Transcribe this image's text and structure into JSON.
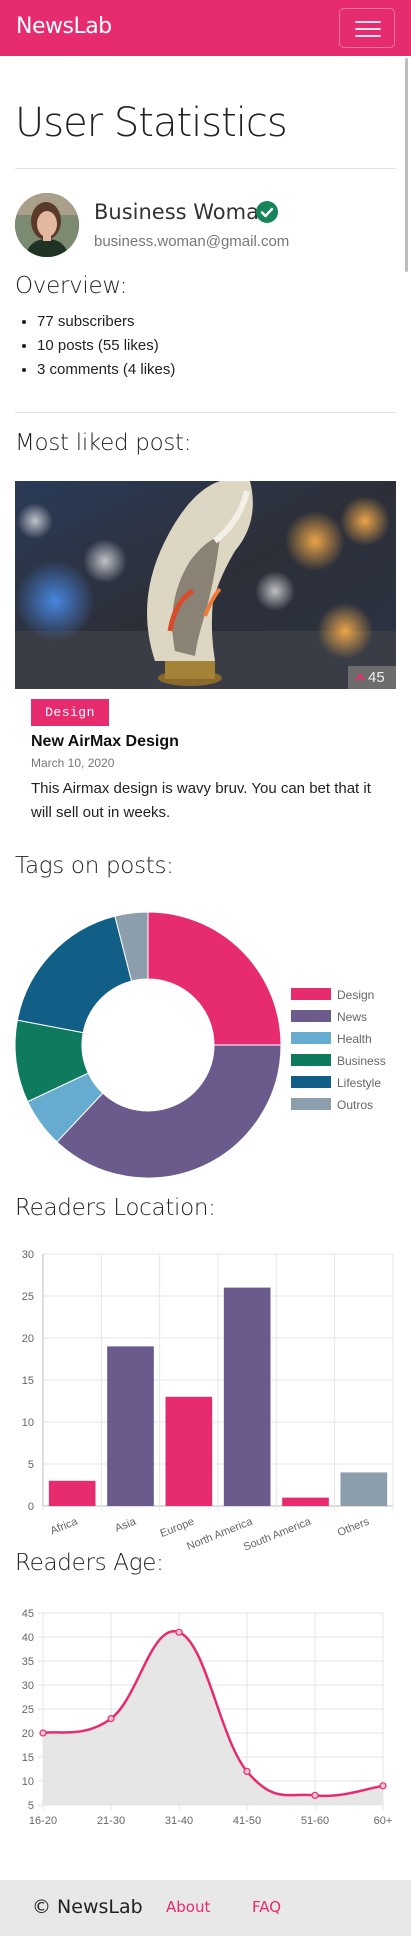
{
  "navbar": {
    "brand": "NewsLab",
    "brand_color": "#e72b6f"
  },
  "page": {
    "title": "User Statistics"
  },
  "user": {
    "name": "Business Woman",
    "email": "business.woman@gmail.com",
    "verified": true
  },
  "overview": {
    "title": "Overview:",
    "items": [
      "77 subscribers",
      "10 posts (55 likes)",
      "3 comments (4 likes)"
    ]
  },
  "most_liked": {
    "title": "Most liked post:",
    "likes": "45",
    "tag": "Design",
    "post_title": "New AirMax Design",
    "date": "March 10, 2020",
    "text": "This Airmax design is wavy bruv. You can bet that it will sell out in weeks."
  },
  "tags_section": {
    "title": "Tags on posts:"
  },
  "location_section": {
    "title": "Readers Location:"
  },
  "age_section": {
    "title": "Readers Age:"
  },
  "footer": {
    "brand": "© NewsLab",
    "links": [
      "About",
      "FAQ"
    ]
  },
  "chart_data": [
    {
      "type": "pie",
      "variant": "doughnut",
      "labels": [
        "Design",
        "News",
        "Health",
        "Business",
        "Lifestyle",
        "Outros"
      ],
      "values": [
        25,
        37,
        6,
        10,
        18,
        4
      ],
      "colors": [
        "#e72b6f",
        "#6b5b8c",
        "#66acd0",
        "#0f7a5d",
        "#115f87",
        "#8c9dac"
      ],
      "legend": "right"
    },
    {
      "type": "bar",
      "categories": [
        "Africa",
        "Asia",
        "Europe",
        "North America",
        "South America",
        "Others"
      ],
      "values": [
        3,
        19,
        13,
        26,
        1,
        4
      ],
      "colors": [
        "#e72b6f",
        "#6b5b8c",
        "#e72b6f",
        "#6b5b8c",
        "#e72b6f",
        "#8c9dac"
      ],
      "ylim": [
        0,
        30
      ],
      "yticks": [
        0,
        5,
        10,
        15,
        20,
        25,
        30
      ],
      "grid": true
    },
    {
      "type": "area",
      "categories": [
        "16-20",
        "21-30",
        "31-40",
        "41-50",
        "51-60",
        "60+"
      ],
      "values": [
        20,
        23,
        41,
        12,
        7,
        9
      ],
      "line_color": "#e72b6f",
      "fill_color": "#e3e3e3",
      "ylim": [
        5,
        45
      ],
      "yticks": [
        5,
        10,
        15,
        20,
        25,
        30,
        35,
        40,
        45
      ],
      "grid": true
    }
  ]
}
